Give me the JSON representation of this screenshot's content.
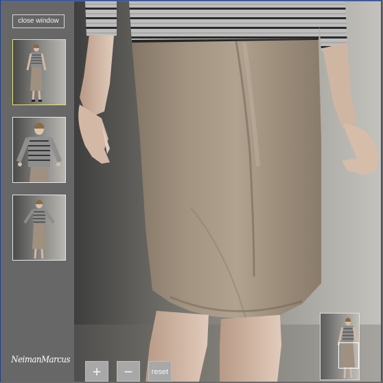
{
  "window": {
    "close_label": "close window"
  },
  "sidebar": {
    "thumbnails": [
      {
        "label": "",
        "selected": true
      },
      {
        "label": "",
        "selected": false
      },
      {
        "label": "",
        "selected": false
      }
    ],
    "logo_text": "NeimanMarcus"
  },
  "zoom_controls": {
    "zoom_in_glyph": "+",
    "zoom_out_glyph": "−",
    "reset_label": "reset"
  },
  "colors": {
    "frame_border": "#1c3d8c",
    "sidebar_bg": "#676767",
    "selected_thumb_border": "#e9e56a",
    "skirt": "#9e8f7d",
    "sweater_stripe_dark": "#2a2a2a",
    "sweater_stripe_light": "#bdbdbd"
  },
  "icons": {
    "zoom_in": "plus-icon",
    "zoom_out": "minus-icon"
  }
}
